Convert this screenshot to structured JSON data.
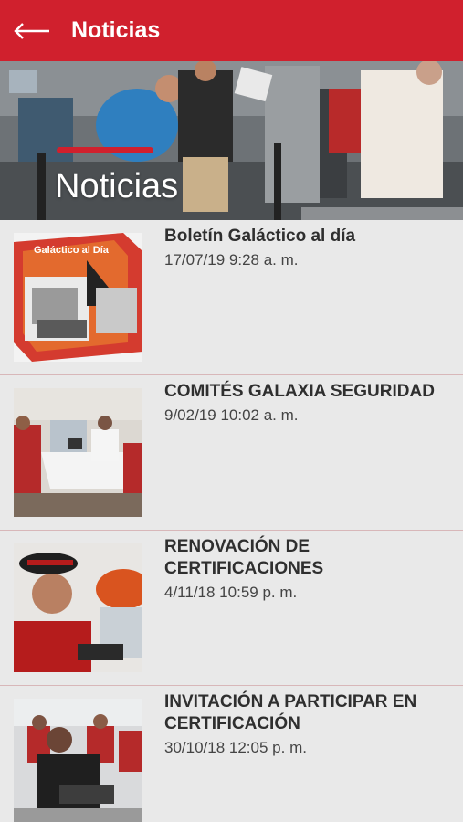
{
  "app_bar": {
    "title": "Noticias",
    "back_icon": "arrow-left-icon",
    "background": "#d0202d"
  },
  "hero": {
    "title": "Noticias",
    "accent_color": "#d0202d"
  },
  "news": [
    {
      "title": "Boletín Galáctico al día",
      "date": "17/07/19 9:28 a. m.",
      "thumb_text": "Galáctico al Día"
    },
    {
      "title": "COMITÉS GALAXIA SEGURIDAD",
      "date": "9/02/19 10:02 a. m."
    },
    {
      "title": "RENOVACIÓN DE CERTIFICACIONES",
      "date": "4/11/18 10:59 p. m."
    },
    {
      "title": "INVITACIÓN A PARTICIPAR EN CERTIFICACIÓN",
      "date": "30/10/18 12:05 p. m."
    }
  ]
}
